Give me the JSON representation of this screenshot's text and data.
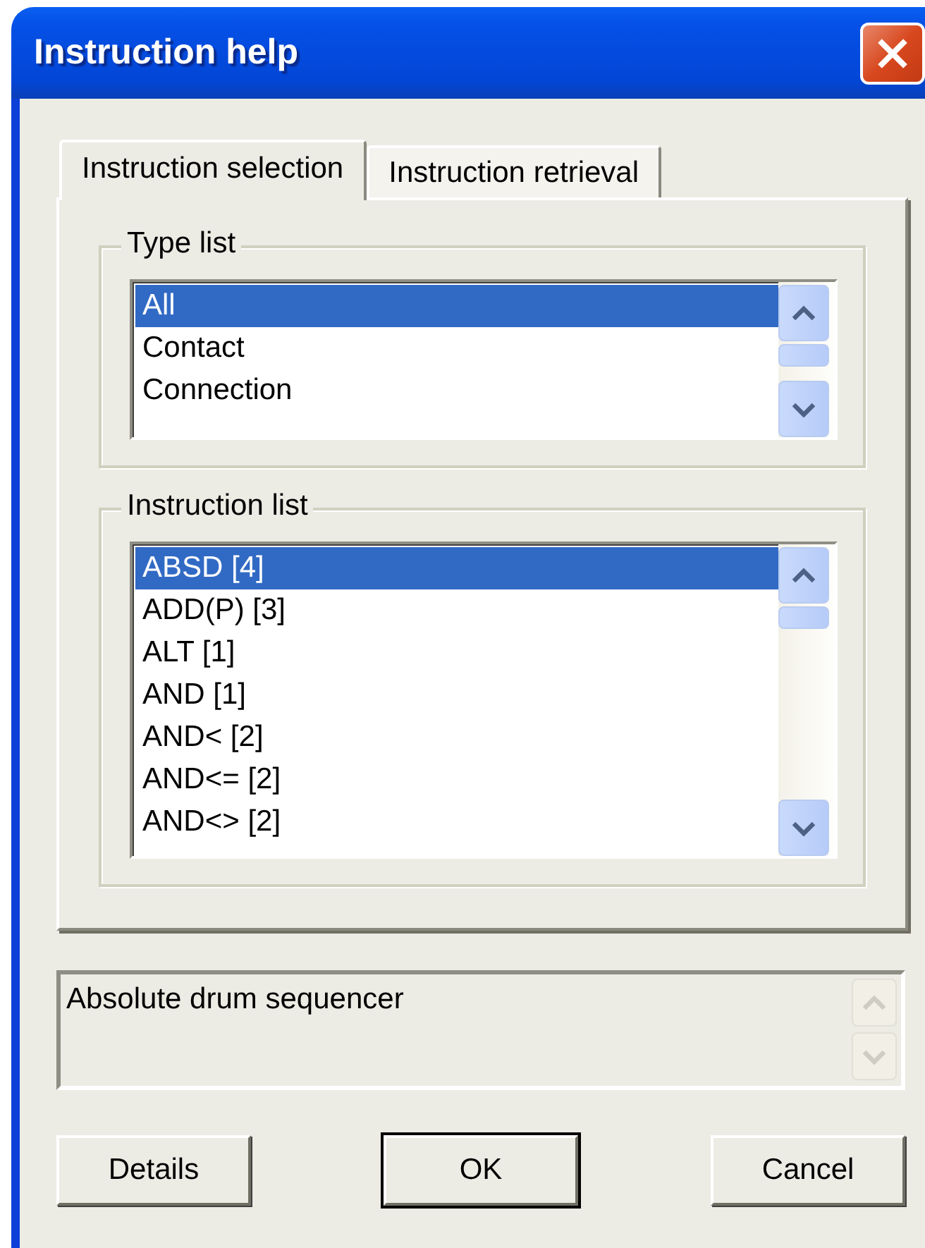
{
  "window": {
    "title": "Instruction help"
  },
  "tabs": [
    {
      "label": "Instruction selection",
      "selected": true
    },
    {
      "label": "Instruction retrieval",
      "selected": false
    }
  ],
  "type_list": {
    "label": "Type list",
    "items": [
      {
        "text": "All",
        "selected": true
      },
      {
        "text": "Contact",
        "selected": false
      },
      {
        "text": "Connection",
        "selected": false
      }
    ]
  },
  "instruction_list": {
    "label": "Instruction list",
    "items": [
      {
        "text": "ABSD [4]",
        "selected": true
      },
      {
        "text": "ADD(P) [3]",
        "selected": false
      },
      {
        "text": "ALT [1]",
        "selected": false
      },
      {
        "text": "AND [1]",
        "selected": false
      },
      {
        "text": "AND< [2]",
        "selected": false
      },
      {
        "text": "AND<= [2]",
        "selected": false
      },
      {
        "text": "AND<> [2]",
        "selected": false
      }
    ]
  },
  "description": {
    "text": "Absolute drum sequencer"
  },
  "buttons": [
    {
      "label": "Details",
      "default": false
    },
    {
      "label": "OK",
      "default": true
    },
    {
      "label": "Cancel",
      "default": false
    }
  ]
}
